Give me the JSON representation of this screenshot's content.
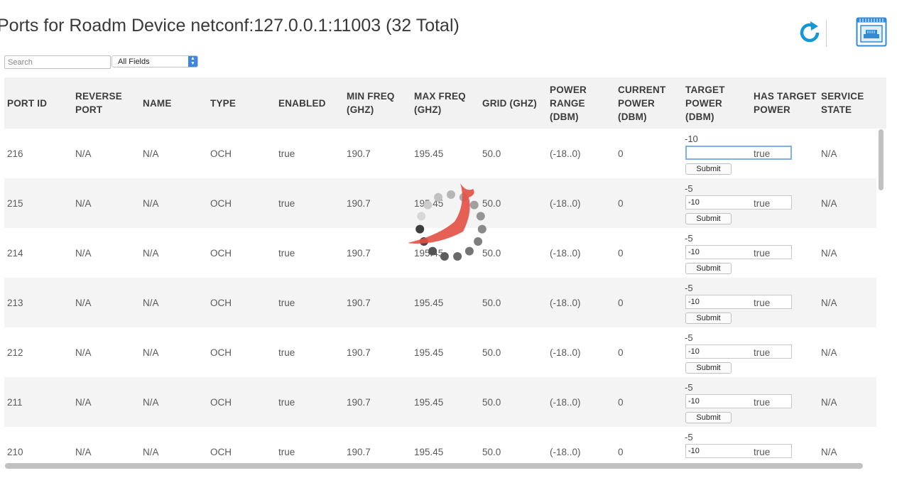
{
  "header": {
    "title": "Ports for Roadm Device netconf:127.0.0.1:11003 (32 Total)"
  },
  "toolbar": {
    "refresh_icon": "refresh-icon",
    "port_view_icon": "ethernet-port-icon"
  },
  "search": {
    "placeholder": "Search",
    "value": "",
    "field_selected": "All Fields"
  },
  "table": {
    "columns": [
      {
        "key": "port_id",
        "lines": [
          "PORT ID"
        ]
      },
      {
        "key": "reverse_port",
        "lines": [
          "REVERSE",
          "PORT"
        ]
      },
      {
        "key": "name",
        "lines": [
          "NAME"
        ]
      },
      {
        "key": "type",
        "lines": [
          "TYPE"
        ]
      },
      {
        "key": "enabled",
        "lines": [
          "ENABLED"
        ]
      },
      {
        "key": "min_freq",
        "lines": [
          "MIN FREQ",
          "(GHZ)"
        ]
      },
      {
        "key": "max_freq",
        "lines": [
          "MAX FREQ",
          "(GHZ)"
        ]
      },
      {
        "key": "grid",
        "lines": [
          "GRID (GHZ)"
        ]
      },
      {
        "key": "power_range",
        "lines": [
          "POWER",
          "RANGE",
          "(DBM)"
        ]
      },
      {
        "key": "current_power",
        "lines": [
          "CURRENT",
          "POWER",
          "(DBM)"
        ]
      },
      {
        "key": "target_power",
        "lines": [
          "TARGET",
          "POWER",
          "(DBM)"
        ]
      },
      {
        "key": "has_target_power",
        "lines": [
          "HAS TARGET",
          "POWER"
        ]
      },
      {
        "key": "service_state",
        "lines": [
          "SERVICE",
          "STATE"
        ]
      }
    ],
    "submit_label": "Submit",
    "rows": [
      {
        "port_id": "216",
        "reverse_port": "N/A",
        "name": "N/A",
        "type": "OCH",
        "enabled": "true",
        "min_freq": "190.7",
        "max_freq": "195.45",
        "grid": "50.0",
        "power_range": "(-18..0)",
        "current_power": "0",
        "target_power": "-10",
        "target_input": "",
        "has_target_power": "true",
        "service_state": "N/A"
      },
      {
        "port_id": "215",
        "reverse_port": "N/A",
        "name": "N/A",
        "type": "OCH",
        "enabled": "true",
        "min_freq": "190.7",
        "max_freq": "195.45",
        "grid": "50.0",
        "power_range": "(-18..0)",
        "current_power": "0",
        "target_power": "-5",
        "target_input": "-10",
        "has_target_power": "true",
        "service_state": "N/A"
      },
      {
        "port_id": "214",
        "reverse_port": "N/A",
        "name": "N/A",
        "type": "OCH",
        "enabled": "true",
        "min_freq": "190.7",
        "max_freq": "195.45",
        "grid": "50.0",
        "power_range": "(-18..0)",
        "current_power": "0",
        "target_power": "-5",
        "target_input": "-10",
        "has_target_power": "true",
        "service_state": "N/A"
      },
      {
        "port_id": "213",
        "reverse_port": "N/A",
        "name": "N/A",
        "type": "OCH",
        "enabled": "true",
        "min_freq": "190.7",
        "max_freq": "195.45",
        "grid": "50.0",
        "power_range": "(-18..0)",
        "current_power": "0",
        "target_power": "-5",
        "target_input": "-10",
        "has_target_power": "true",
        "service_state": "N/A"
      },
      {
        "port_id": "212",
        "reverse_port": "N/A",
        "name": "N/A",
        "type": "OCH",
        "enabled": "true",
        "min_freq": "190.7",
        "max_freq": "195.45",
        "grid": "50.0",
        "power_range": "(-18..0)",
        "current_power": "0",
        "target_power": "-5",
        "target_input": "-10",
        "has_target_power": "true",
        "service_state": "N/A"
      },
      {
        "port_id": "211",
        "reverse_port": "N/A",
        "name": "N/A",
        "type": "OCH",
        "enabled": "true",
        "min_freq": "190.7",
        "max_freq": "195.45",
        "grid": "50.0",
        "power_range": "(-18..0)",
        "current_power": "0",
        "target_power": "-5",
        "target_input": "-10",
        "has_target_power": "true",
        "service_state": "N/A"
      },
      {
        "port_id": "210",
        "reverse_port": "N/A",
        "name": "N/A",
        "type": "OCH",
        "enabled": "true",
        "min_freq": "190.7",
        "max_freq": "195.45",
        "grid": "50.0",
        "power_range": "(-18..0)",
        "current_power": "0",
        "target_power": "-5",
        "target_input": "-10",
        "has_target_power": "true",
        "service_state": "N/A"
      }
    ]
  },
  "loading": {
    "icon": "loading-spinner-icon",
    "logo": "bird-logo-icon"
  },
  "colors": {
    "accent": "#3d86e0",
    "refresh": "#1497d6",
    "logo": "#e34f43",
    "header_bg": "#f2f2f2",
    "row_alt_bg": "#f4f4f4"
  }
}
